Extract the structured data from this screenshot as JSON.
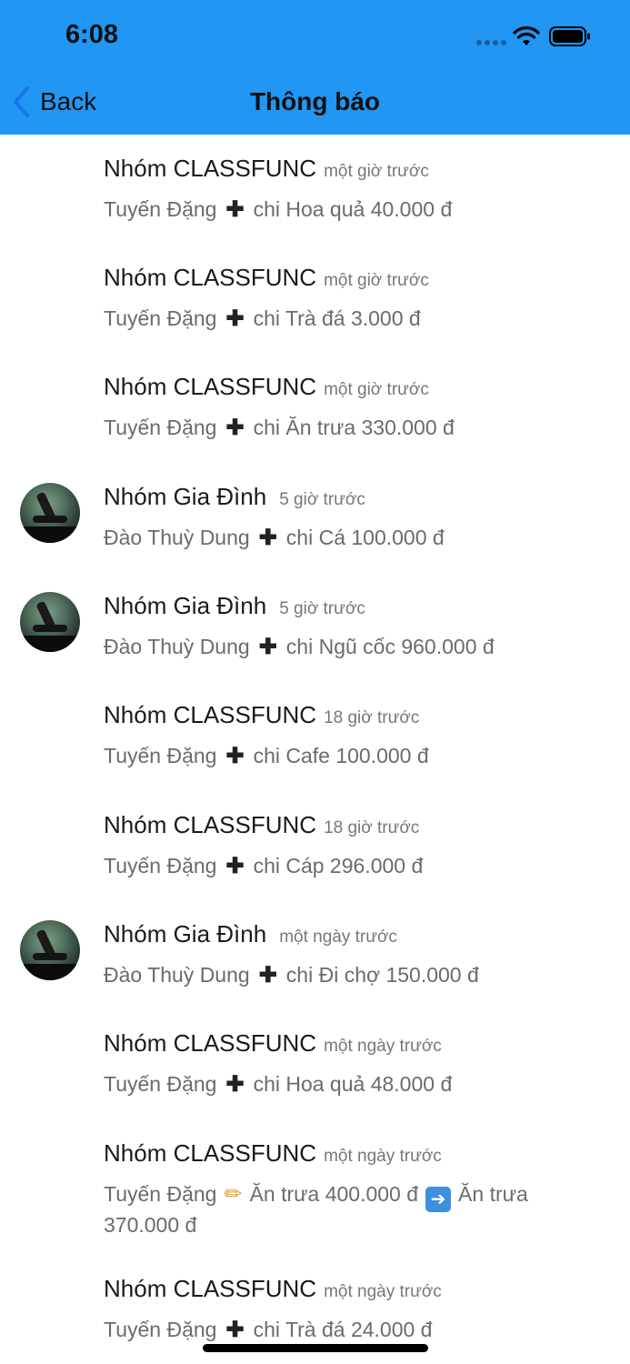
{
  "status_bar": {
    "time": "6:08"
  },
  "nav": {
    "back_label": "Back",
    "title": "Thông báo"
  },
  "notifications": [
    {
      "group": "Nhóm CLASSFUNC",
      "time": "một giờ trước",
      "user": "Tuyến Đặng",
      "action_icon": "plus-icon",
      "text": "chi Hoa quả 40.000 đ"
    },
    {
      "group": "Nhóm CLASSFUNC",
      "time": "một giờ trước",
      "user": "Tuyến Đặng",
      "action_icon": "plus-icon",
      "text": "chi Trà đá 3.000 đ"
    },
    {
      "group": "Nhóm CLASSFUNC",
      "time": "một giờ trước",
      "user": "Tuyến Đặng",
      "action_icon": "plus-icon",
      "text": "chi Ăn trưa 330.000 đ"
    },
    {
      "group": "Nhóm Gia Đình",
      "time": "5 giờ trước",
      "user": "Đào Thuỳ Dung",
      "action_icon": "plus-icon",
      "text": "chi Cá 100.000 đ",
      "avatar": true
    },
    {
      "group": "Nhóm Gia Đình",
      "time": "5 giờ trước",
      "user": "Đào Thuỳ Dung",
      "action_icon": "plus-icon",
      "text": "chi Ngũ cốc 960.000 đ",
      "avatar": true
    },
    {
      "group": "Nhóm CLASSFUNC",
      "time": "18 giờ trước",
      "user": "Tuyến Đặng",
      "action_icon": "plus-icon",
      "text": "chi Cafe 100.000 đ"
    },
    {
      "group": "Nhóm CLASSFUNC",
      "time": "18 giờ trước",
      "user": "Tuyến Đặng",
      "action_icon": "plus-icon",
      "text": "chi Cáp 296.000 đ"
    },
    {
      "group": "Nhóm Gia Đình",
      "time": "một ngày trước",
      "user": "Đào Thuỳ Dung",
      "action_icon": "plus-icon",
      "text": "chi Đi chợ 150.000 đ",
      "avatar": true
    },
    {
      "group": "Nhóm CLASSFUNC",
      "time": "một ngày trước",
      "user": "Tuyến Đặng",
      "action_icon": "plus-icon",
      "text": "chi Hoa quả 48.000 đ"
    },
    {
      "group": "Nhóm CLASSFUNC",
      "time": "một ngày trước",
      "user": "Tuyến Đặng",
      "action_icon": "pencil-icon",
      "text": "Ăn trưa 400.000 đ",
      "arrow_icon": "right-arrow-icon",
      "text2": "Ăn trưa 370.000 đ"
    },
    {
      "group": "Nhóm CLASSFUNC",
      "time": "một ngày trước",
      "user": "Tuyến Đặng",
      "action_icon": "plus-icon",
      "text": "chi Trà đá 24.000 đ"
    }
  ]
}
